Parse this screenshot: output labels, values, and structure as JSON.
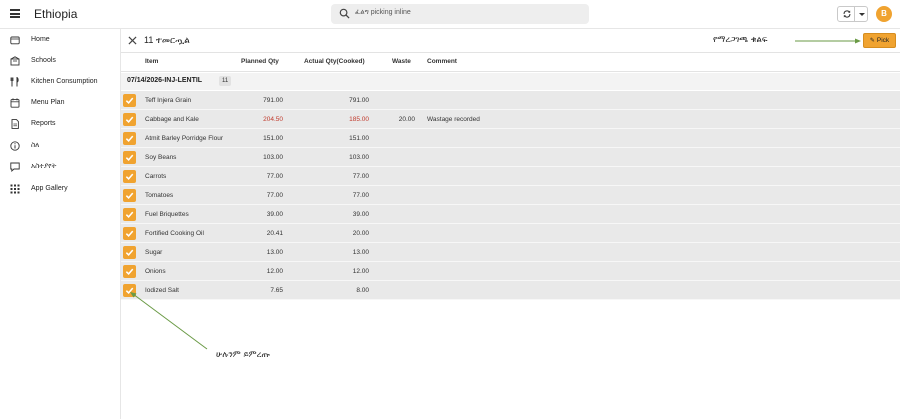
{
  "app": {
    "title": "Ethiopia"
  },
  "search": {
    "placeholder": "ፈልግ picking inline"
  },
  "user": {
    "initial": "B",
    "avatar_color": "#f0a330"
  },
  "sidebar": {
    "items": [
      {
        "label": "Home",
        "icon": "home-icon"
      },
      {
        "label": "Schools",
        "icon": "school-icon"
      },
      {
        "label": "Kitchen Consumption",
        "icon": "utensils-icon"
      },
      {
        "label": "Menu Plan",
        "icon": "calendar-icon"
      },
      {
        "label": "Reports",
        "icon": "report-icon"
      },
      {
        "label": "ስለ",
        "icon": "info-icon"
      },
      {
        "label": "አስተያየት",
        "icon": "feedback-icon"
      },
      {
        "label": "App Gallery",
        "icon": "grid-icon"
      }
    ]
  },
  "toolbar": {
    "selected_label": "11 ተመርጧል",
    "pick_label": "Pick",
    "pick_color": "#f0a330"
  },
  "columns": {
    "item": "Item",
    "planned": "Planned Qty",
    "actual": "Actual Qty(Cooked)",
    "waste": "Waste",
    "comment": "Comment"
  },
  "group": {
    "label": "07/14/2026-INJ-LENTIL",
    "count": "11"
  },
  "rows": [
    {
      "item": "Teff Injera Grain",
      "planned": "791.00",
      "actual": "791.00",
      "waste": "",
      "comment": "",
      "highlight": false
    },
    {
      "item": "Cabbage and Kale",
      "planned": "204.50",
      "actual": "185.00",
      "waste": "20.00",
      "comment": "Wastage recorded",
      "highlight": true
    },
    {
      "item": "Atmit Barley Porridge Flour",
      "planned": "151.00",
      "actual": "151.00",
      "waste": "",
      "comment": "",
      "highlight": false
    },
    {
      "item": "Soy Beans",
      "planned": "103.00",
      "actual": "103.00",
      "waste": "",
      "comment": "",
      "highlight": false
    },
    {
      "item": "Carrots",
      "planned": "77.00",
      "actual": "77.00",
      "waste": "",
      "comment": "",
      "highlight": false
    },
    {
      "item": "Tomatoes",
      "planned": "77.00",
      "actual": "77.00",
      "waste": "",
      "comment": "",
      "highlight": false
    },
    {
      "item": "Fuel Briquettes",
      "planned": "39.00",
      "actual": "39.00",
      "waste": "",
      "comment": "",
      "highlight": false
    },
    {
      "item": "Fortified Cooking Oil",
      "planned": "20.41",
      "actual": "20.00",
      "waste": "",
      "comment": "",
      "highlight": false
    },
    {
      "item": "Sugar",
      "planned": "13.00",
      "actual": "13.00",
      "waste": "",
      "comment": "",
      "highlight": false
    },
    {
      "item": "Onions",
      "planned": "12.00",
      "actual": "12.00",
      "waste": "",
      "comment": "",
      "highlight": false
    },
    {
      "item": "Iodized Salt",
      "planned": "7.65",
      "actual": "8.00",
      "waste": "",
      "comment": "",
      "highlight": false
    }
  ],
  "annotations": {
    "pick_button": "የማረጋገጫ ቁልፍ",
    "select_all": "ሁሉንም ይምረጡ",
    "line_color": "#6a9a45"
  }
}
